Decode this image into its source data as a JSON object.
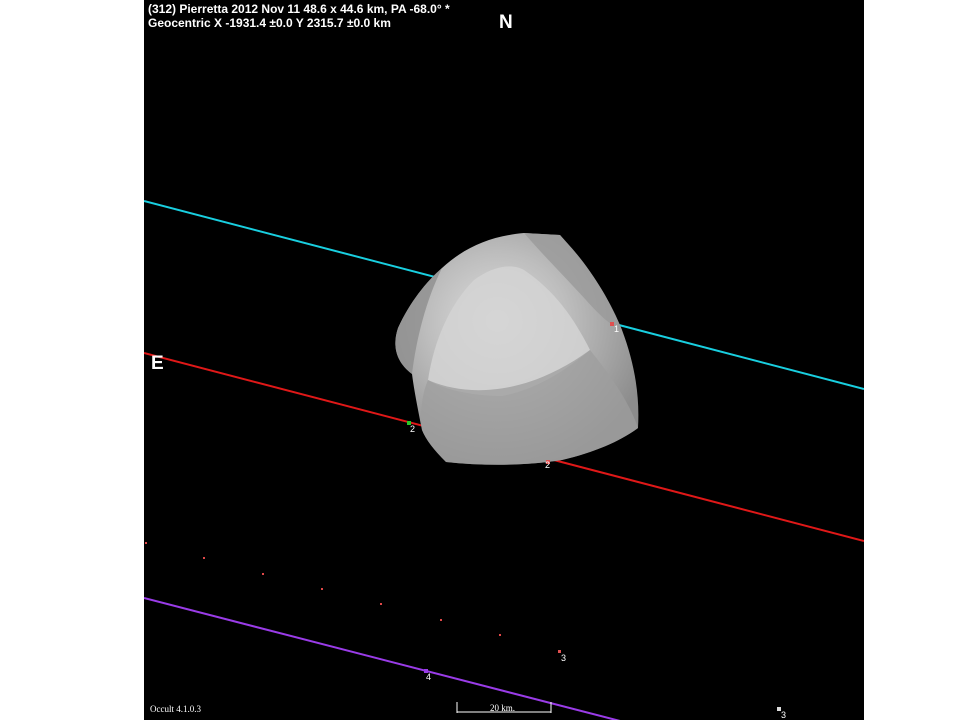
{
  "header": {
    "line1": "(312) Pierretta  2012 Nov 11  48.6 x 44.6 km, PA -68.0° *",
    "line2": "Geocentric  X  -1931.4 ±0.0  Y 2315.7 ±0.0 km"
  },
  "directions": {
    "north": "N",
    "east": "E"
  },
  "software_version": "Occult 4.1.0.3",
  "scale_bar_label": "20 km.",
  "chords": [
    {
      "id": "1",
      "color": "#19cfe0",
      "label": "1"
    },
    {
      "id": "2",
      "color": "#e01818",
      "label": "2"
    },
    {
      "id": "3",
      "color": "#e03c3c",
      "label": "3",
      "style": "dotted"
    },
    {
      "id": "4",
      "color": "#9a3ce8",
      "label": "4"
    }
  ],
  "markers": [
    "1",
    "2",
    "2",
    "3",
    "4",
    "3"
  ],
  "colors": {
    "background": "#000000",
    "asteroid": "#a8a8a8",
    "text": "#ffffff"
  }
}
